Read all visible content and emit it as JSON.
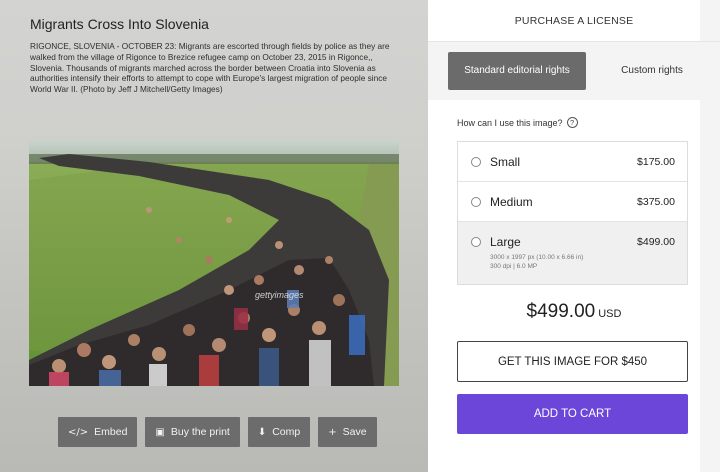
{
  "article": {
    "title": "Migrants Cross Into Slovenia",
    "caption": "RIGONCE, SLOVENIA - OCTOBER 23: Migrants are escorted through fields by police as they are walked from the village of Rigonce to Brezice refugee camp on October 23, 2015 in Rigonce,, Slovenia. Thousands of migrants marched across the border between Croatia into Slovenia as authorities intensify their efforts to attempt to cope with Europe's largest migration of people since World War II. (Photo by Jeff J Mitchell/Getty Images)",
    "watermark": "gettyimages"
  },
  "actions": {
    "embed": {
      "label": "Embed",
      "icon": "code-icon"
    },
    "print": {
      "label": "Buy the print",
      "icon": "image-icon"
    },
    "comp": {
      "label": "Comp",
      "icon": "download-icon"
    },
    "save": {
      "label": "Save",
      "icon": "plus-icon"
    }
  },
  "purchase": {
    "header": "PURCHASE A LICENSE",
    "tab_standard": "Standard editorial rights",
    "tab_custom": "Custom rights",
    "how_can": "How can I use this image?",
    "sizes": [
      {
        "name": "Small",
        "price": "$175.00"
      },
      {
        "name": "Medium",
        "price": "$375.00"
      },
      {
        "name": "Large",
        "price": "$499.00",
        "detail1": "3000 x 1997 px (10.00 x 6.66 in)",
        "detail2": "300 dpi | 6.0 MP"
      }
    ],
    "total": "$499.00",
    "currency": "USD",
    "get_button": "GET THIS IMAGE FOR $450",
    "cart_button": "ADD TO CART"
  },
  "colors": {
    "accent": "#6b46d8",
    "button_gray": "#6c6c6c",
    "tab_active": "#6b6b6b"
  }
}
